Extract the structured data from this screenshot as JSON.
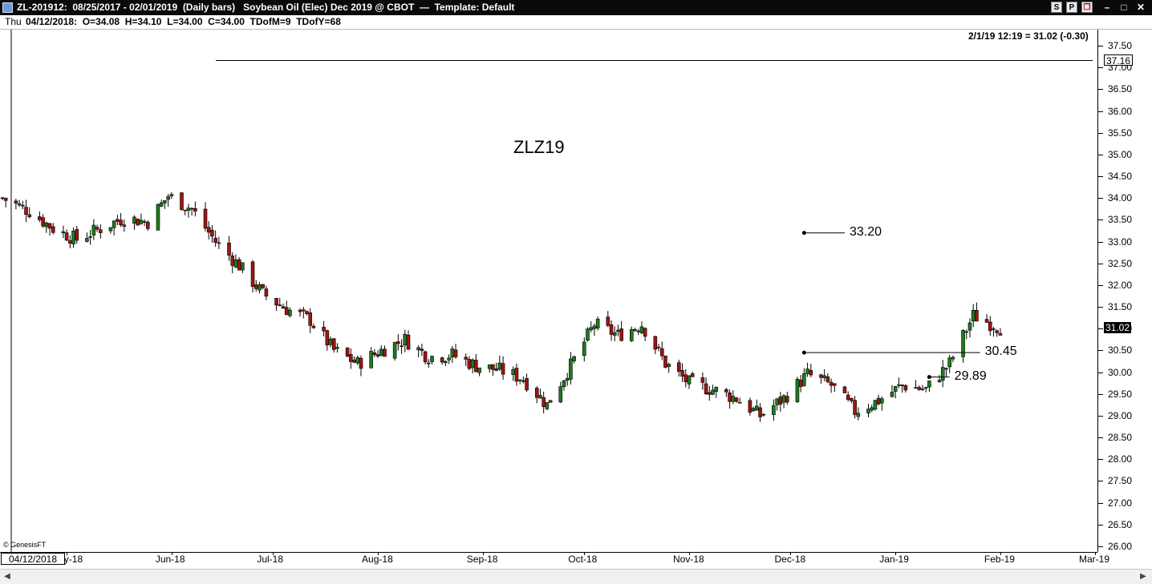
{
  "window": {
    "title": "ZL-201912:  08/25/2017 - 02/01/2019  (Daily bars)   Soybean Oil (Elec) Dec 2019 @ CBOT  —  Template: Default",
    "buttons": [
      "S",
      "P",
      "❐"
    ],
    "controls": [
      "–",
      "□",
      "✕"
    ]
  },
  "infobar": {
    "day": "Thu",
    "ohlc": "04/12/2018:  O=34.08  H=34.10  L=34.00  C=34.00  TDofM=9  TDofY=68"
  },
  "status": "2/1/19 12:19 = 31.02 (-0.30)",
  "chart_title": "ZLZ19",
  "date_box": "04/12/2018",
  "watermark": "© GenesisFT",
  "colors": {
    "up": "#1e7a1e",
    "down": "#a01414",
    "tag_last_bg": "#000000",
    "tag_last_fg": "#ffffff"
  },
  "chart_data": {
    "type": "candlestick",
    "symbol": "ZLZ19",
    "ylim": [
      26.0,
      37.5
    ],
    "y_ticks": [
      "37.50",
      "37.00",
      "36.50",
      "36.00",
      "35.50",
      "35.00",
      "34.50",
      "34.00",
      "33.50",
      "33.00",
      "32.50",
      "32.00",
      "31.50",
      "31.00",
      "30.50",
      "30.00",
      "29.50",
      "29.00",
      "28.50",
      "28.00",
      "27.50",
      "27.00",
      "26.50",
      "26.00"
    ],
    "x_ticks": [
      "May-18",
      "Jun-18",
      "Jul-18",
      "Aug-18",
      "Sep-18",
      "Oct-18",
      "Nov-18",
      "Dec-18",
      "Jan-19",
      "Feb-19",
      "Mar-19"
    ],
    "x_range": [
      "2018-04-12",
      "2019-03-01"
    ],
    "horizontal_line": 37.16,
    "horizontal_line_label": "37.16",
    "last_price": 31.02,
    "last_price_label": "31.02",
    "annotations": [
      {
        "label": "33.20",
        "value": 33.2,
        "from": "2018-12-05",
        "to": "2018-12-17"
      },
      {
        "label": "30.45",
        "value": 30.45,
        "from": "2018-12-05",
        "to": "2019-01-26"
      },
      {
        "label": "29.89",
        "value": 29.89,
        "from": "2019-01-11",
        "to": "2019-01-17"
      }
    ],
    "closes": [
      [
        "2018-04-12",
        34.0
      ],
      [
        "2018-04-20",
        33.7
      ],
      [
        "2018-04-27",
        33.3
      ],
      [
        "2018-05-04",
        33.05
      ],
      [
        "2018-05-11",
        33.3
      ],
      [
        "2018-05-18",
        33.55
      ],
      [
        "2018-05-25",
        33.45
      ],
      [
        "2018-05-31",
        34.05
      ],
      [
        "2018-06-07",
        33.75
      ],
      [
        "2018-06-14",
        33.0
      ],
      [
        "2018-06-21",
        32.45
      ],
      [
        "2018-06-28",
        31.8
      ],
      [
        "2018-07-05",
        31.45
      ],
      [
        "2018-07-12",
        31.2
      ],
      [
        "2018-07-19",
        30.5
      ],
      [
        "2018-07-26",
        30.2
      ],
      [
        "2018-08-02",
        30.5
      ],
      [
        "2018-08-09",
        30.75
      ],
      [
        "2018-08-16",
        30.35
      ],
      [
        "2018-08-23",
        30.4
      ],
      [
        "2018-08-30",
        30.15
      ],
      [
        "2018-09-06",
        30.05
      ],
      [
        "2018-09-13",
        29.85
      ],
      [
        "2018-09-20",
        29.25
      ],
      [
        "2018-09-27",
        30.15
      ],
      [
        "2018-10-04",
        31.1
      ],
      [
        "2018-10-11",
        30.85
      ],
      [
        "2018-10-18",
        31.1
      ],
      [
        "2018-10-25",
        30.2
      ],
      [
        "2018-11-01",
        29.75
      ],
      [
        "2018-11-08",
        29.6
      ],
      [
        "2018-11-15",
        29.4
      ],
      [
        "2018-11-22",
        29.0
      ],
      [
        "2018-11-29",
        29.4
      ],
      [
        "2018-12-06",
        29.95
      ],
      [
        "2018-12-13",
        29.7
      ],
      [
        "2018-12-20",
        29.1
      ],
      [
        "2018-12-27",
        29.35
      ],
      [
        "2019-01-03",
        29.7
      ],
      [
        "2019-01-10",
        29.6
      ],
      [
        "2019-01-17",
        30.2
      ],
      [
        "2019-01-24",
        31.3
      ],
      [
        "2019-02-01",
        31.02
      ]
    ]
  }
}
